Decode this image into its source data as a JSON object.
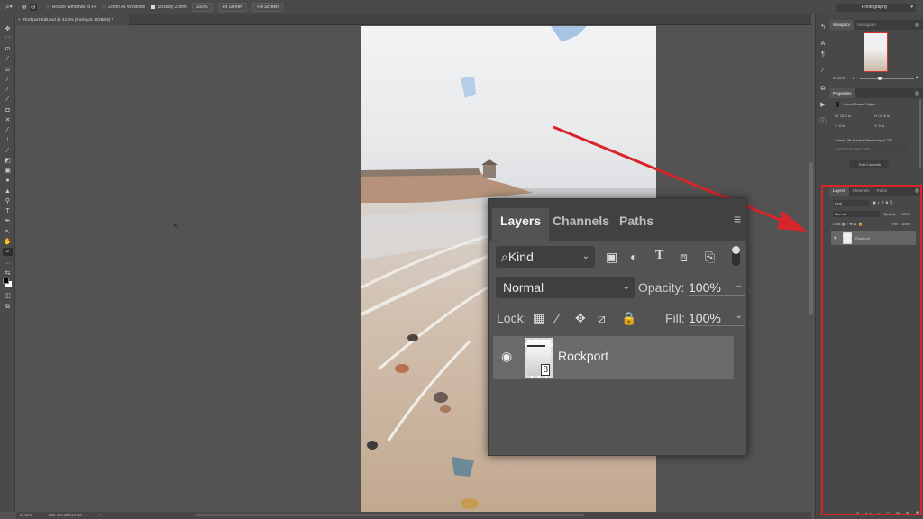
{
  "options_bar": {
    "resize_windows_label": "Resize Windows to Fit",
    "zoom_all_label": "Zoom All Windows",
    "scrubby_zoom_label": "Scrubby Zoom",
    "zoom_value": "100%",
    "fit_screen_label": "Fit Screen",
    "fill_screen_label": "Fill Screen",
    "workspace": "Photography"
  },
  "document": {
    "tab_title": "Rockport-Edit.psd @ 44.8% (Rockport, RGB/16) *"
  },
  "status_bar": {
    "zoom": "44.81%",
    "doc_size": "Doc: 114.3M/114.3M"
  },
  "navigator": {
    "tabs": [
      "Navigator",
      "Histogram"
    ],
    "zoom": "44.81%"
  },
  "properties": {
    "title": "Properties",
    "type": "Linked Smart Object",
    "w": "W: 15.0 in",
    "h": "H: 22.6 in",
    "x": "X: 0 in",
    "y": "Y: 0 in",
    "path": "/Users/.../Ps Practice Files/Rockport.CR2",
    "layer_comp_placeholder": "Don't Apply Layer Comp",
    "edit_button": "Edit Contents"
  },
  "layers_small": {
    "tabs": [
      "Layers",
      "Channels",
      "Paths"
    ],
    "kind": "Kind",
    "blend": "Normal",
    "opacity_label": "Opacity:",
    "opacity": "100%",
    "lock_label": "Lock:",
    "fill_label": "Fill:",
    "fill": "100%",
    "layer_name": "Rockport"
  },
  "layers_zoomed": {
    "tabs": [
      "Layers",
      "Channels",
      "Paths"
    ],
    "kind": "Kind",
    "blend": "Normal",
    "opacity_label": "Opacity:",
    "opacity": "100%",
    "lock_label": "Lock:",
    "fill_label": "Fill:",
    "fill": "100%",
    "layer_name": "Rockport"
  },
  "icons": {
    "search": "⌕",
    "eye": "👁",
    "chevron": "⌄",
    "menu": "≡",
    "lock": "🔒",
    "move": "✥",
    "brush": "/",
    "checker": "▦",
    "crop": "⧄",
    "text": "T"
  },
  "colors": {
    "annotation_red": "#d6262b",
    "panel_bg": "#535353"
  }
}
